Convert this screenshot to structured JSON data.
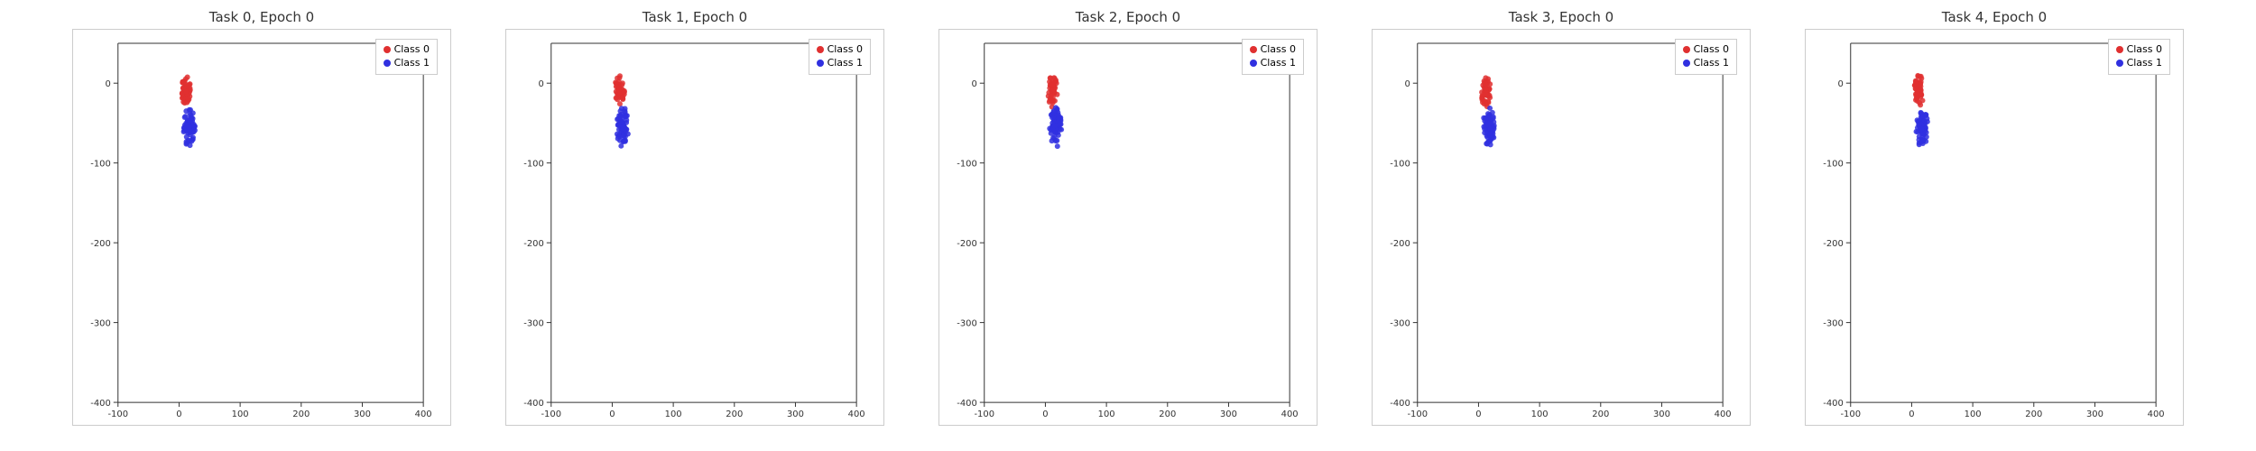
{
  "charts": [
    {
      "title": "Task 0, Epoch 0",
      "id": "chart0"
    },
    {
      "title": "Task 1, Epoch 0",
      "id": "chart1"
    },
    {
      "title": "Task 2, Epoch 0",
      "id": "chart2"
    },
    {
      "title": "Task 3, Epoch 0",
      "id": "chart3"
    },
    {
      "title": "Task 4, Epoch 0",
      "id": "chart4"
    }
  ],
  "legend": {
    "class0": {
      "label": "Class 0",
      "color": "#e03030"
    },
    "class1": {
      "label": "Class 1",
      "color": "#3030e0"
    }
  },
  "axes": {
    "xMin": -100,
    "xMax": 400,
    "yMin": -400,
    "yMax": 50,
    "xTicks": [
      -100,
      0,
      100,
      200,
      300,
      400
    ],
    "yTicks": [
      0,
      -100,
      -200,
      -300,
      -400
    ]
  }
}
